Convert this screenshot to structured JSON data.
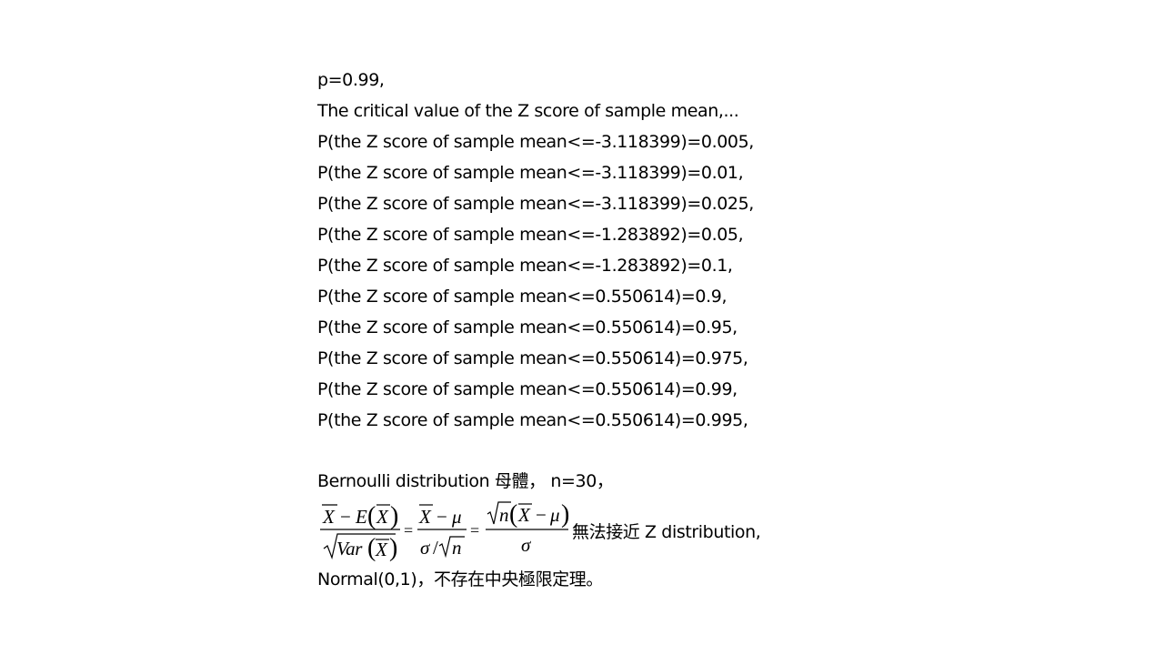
{
  "lines": [
    "p=0.99,",
    "The critical value of the Z score of sample mean,...",
    "P(the Z score of sample mean<=-3.118399)=0.005,",
    "P(the Z score of sample mean<=-3.118399)=0.01,",
    "P(the Z score of sample mean<=-3.118399)=0.025,",
    "P(the Z score of sample mean<=-1.283892)=0.05,",
    "P(the Z score of sample mean<=-1.283892)=0.1,",
    "P(the Z score of sample mean<=0.550614)=0.9,",
    "P(the Z score of sample mean<=0.550614)=0.95,",
    "P(the Z score of sample mean<=0.550614)=0.975,",
    "P(the Z score of sample mean<=0.550614)=0.99,",
    "P(the Z score of sample mean<=0.550614)=0.995,"
  ],
  "bernoulli_line": "Bernoulli distribution 母體，  n=30，",
  "formula": {
    "frac1_num_a": "X",
    "frac1_num_minus": "−",
    "frac1_num_E": "E",
    "frac1_num_b": "X",
    "frac1_den_var": "Var",
    "frac1_den_x": "X",
    "eq1": "=",
    "frac2_num_x": "X",
    "frac2_num_minus": "−",
    "frac2_num_mu": "μ",
    "frac2_den_sigma": "σ",
    "frac2_den_slash": "/",
    "frac2_den_n": "n",
    "eq2": "=",
    "frac3_num_n": "n",
    "frac3_num_x": "X",
    "frac3_num_minus": "−",
    "frac3_num_mu": "μ",
    "frac3_den_sigma": "σ"
  },
  "formula_tail": "無法接近 Z distribution,",
  "final_line": "Normal(0,1)，不存在中央極限定理。"
}
